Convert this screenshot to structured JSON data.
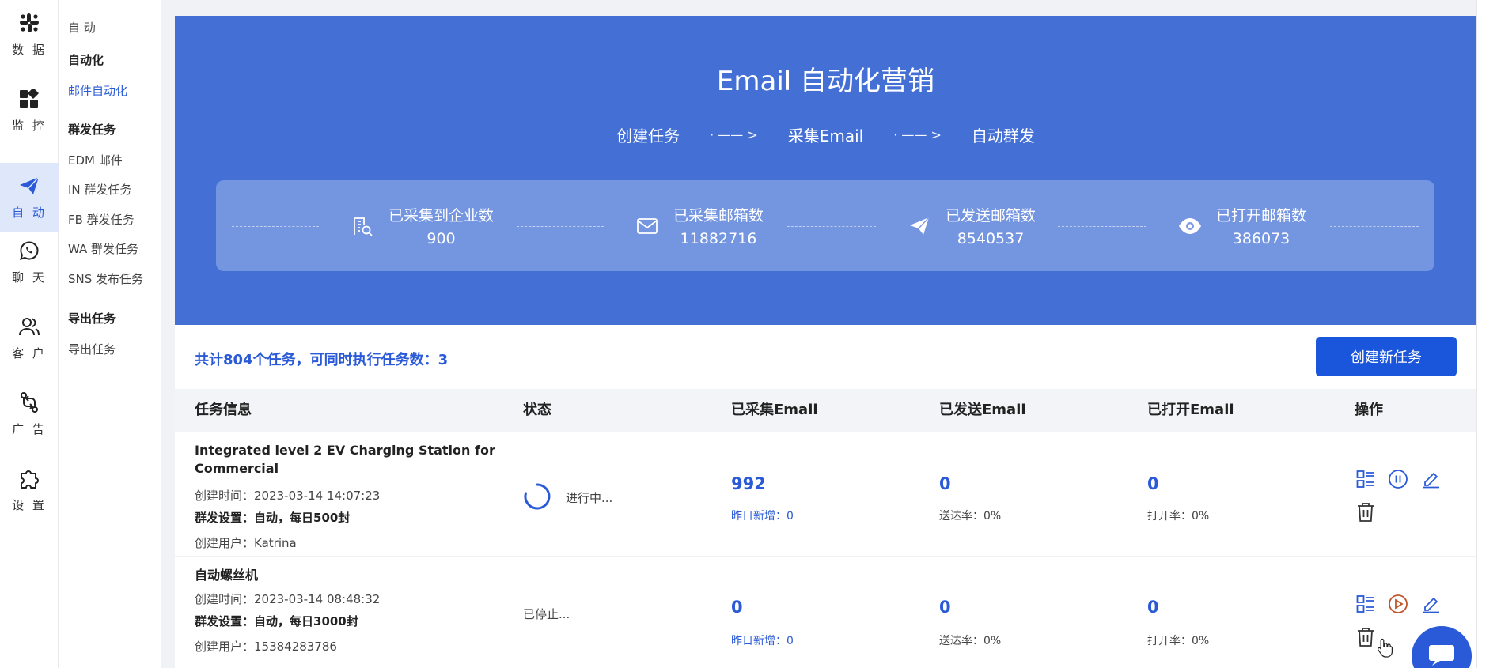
{
  "rail": {
    "items": [
      {
        "label": "数 据",
        "icon": "slack-grid-icon"
      },
      {
        "label": "监 控",
        "icon": "dashboard-tiles-icon"
      },
      {
        "label": "自 动",
        "icon": "paper-plane-icon"
      },
      {
        "label": "聊 天",
        "icon": "whatsapp-icon"
      },
      {
        "label": "客 户",
        "icon": "users-icon"
      },
      {
        "label": "广 告",
        "icon": "git-compare-icon"
      },
      {
        "label": "设 置",
        "icon": "puzzle-icon"
      }
    ]
  },
  "subnav": {
    "section": "自 动",
    "group1": "自动化",
    "email_auto": "邮件自动化",
    "group2": "群发任务",
    "edm": "EDM 邮件",
    "in_task": "IN 群发任务",
    "fb_task": "FB 群发任务",
    "wa_task": "WA 群发任务",
    "sns_task": "SNS 发布任务",
    "group3": "导出任务",
    "export_task": "导出任务"
  },
  "hero": {
    "title": "Email 自动化营销",
    "steps": [
      "创建任务",
      "采集Email",
      "自动群发"
    ],
    "arrow": "· —— >"
  },
  "stats": [
    {
      "label": "已采集到企业数",
      "value": "900",
      "icon": "building-search-icon"
    },
    {
      "label": "已采集邮箱数",
      "value": "11882716",
      "icon": "mail-icon"
    },
    {
      "label": "已发送邮箱数",
      "value": "8540537",
      "icon": "send-icon"
    },
    {
      "label": "已打开邮箱数",
      "value": "386073",
      "icon": "eye-icon"
    }
  ],
  "summary": "共计804个任务，可同时执行任务数：3",
  "create_button": "创建新任务",
  "table": {
    "headers": [
      "任务信息",
      "状态",
      "已采集Email",
      "已发送Email",
      "已打开Email",
      "操作"
    ],
    "rows": [
      {
        "name": "Integrated level 2 EV Charging Station for Commercial",
        "created": "创建时间：2023-03-14 14:07:23",
        "settings": "群发设置：自动，每日500封",
        "user": "创建用户：Katrina",
        "status": "进行中...",
        "collected": "992",
        "collected_sub": "昨日新增：0",
        "sent": "0",
        "sent_sub": "送达率：0%",
        "opened": "0",
        "opened_sub": "打开率：0%"
      },
      {
        "name": "自动螺丝机",
        "created": "创建时间：2023-03-14 08:48:32",
        "settings": "群发设置：自动，每日3000封",
        "user": "创建用户：15384283786",
        "status": "已停止...",
        "collected": "0",
        "collected_sub": "昨日新增：0",
        "sent": "0",
        "sent_sub": "送达率：0%",
        "opened": "0",
        "opened_sub": "打开率：0%"
      }
    ]
  },
  "colors": {
    "accent": "#2a5ad7",
    "hero": "#4470d6",
    "button": "#1a56db",
    "play": "#c0552b"
  }
}
